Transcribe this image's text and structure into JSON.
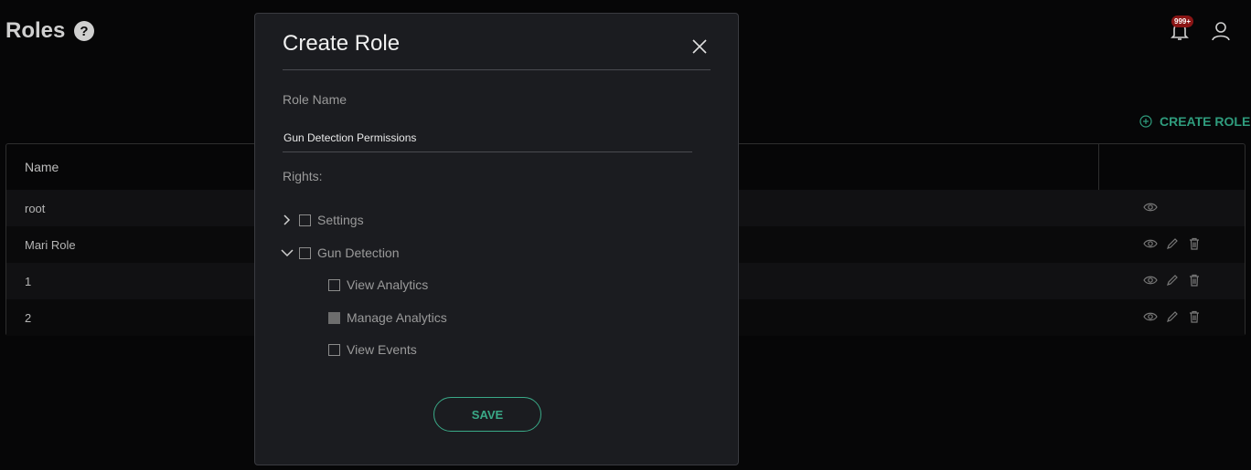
{
  "page": {
    "title": "Roles",
    "help_icon": "question-circle-icon",
    "notifications_badge": "999+",
    "create_role_label": "CREATE ROLE",
    "accent_color": "#2f9c7d"
  },
  "table": {
    "columns": [
      "Name"
    ],
    "rows": [
      {
        "name": "root",
        "actions": [
          "view"
        ]
      },
      {
        "name": "Mari Role",
        "actions": [
          "view",
          "edit",
          "delete"
        ]
      },
      {
        "name": "1",
        "actions": [
          "view",
          "edit",
          "delete"
        ]
      },
      {
        "name": "2",
        "actions": [
          "view",
          "edit",
          "delete"
        ]
      }
    ]
  },
  "modal": {
    "title": "Create Role",
    "role_name_label": "Role Name",
    "role_name_value": "Gun Detection Permissions",
    "rights_label": "Rights:",
    "rights": [
      {
        "label": "Settings",
        "expanded": false,
        "checked": false,
        "children": []
      },
      {
        "label": "Gun Detection",
        "expanded": true,
        "checked": false,
        "children": [
          {
            "label": "View Analytics",
            "checked": false
          },
          {
            "label": "Manage Analytics",
            "checked": "indeterminate"
          },
          {
            "label": "View Events",
            "checked": false
          }
        ]
      }
    ],
    "save_label": "SAVE"
  }
}
